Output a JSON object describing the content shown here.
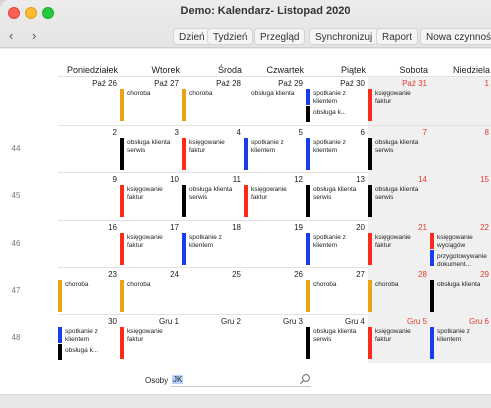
{
  "window": {
    "title": "Demo: Kalendarz- Listopad 2020"
  },
  "nav": {
    "back": "‹",
    "forward": "›"
  },
  "toolbar": [
    "Dzień",
    "Tydzień",
    "Przegląd",
    "Synchronizuj",
    "Raport",
    "Nowa czynność"
  ],
  "days": [
    "Poniedziałek",
    "Wtorek",
    "Środa",
    "Czwartek",
    "Piątek",
    "Sobota",
    "Niedziela"
  ],
  "weeks": [
    "44",
    "45",
    "46",
    "47",
    "48"
  ],
  "osoby": {
    "label": "Osoby",
    "value": "JK"
  },
  "colors": {
    "red": "#ff2a1a",
    "orange": "#e8a317",
    "black": "#000000",
    "blue": "#1a3cf0",
    "weekend": "#f0f0f0"
  },
  "grid": [
    [
      {
        "date": "Paź 26",
        "red": false,
        "events": []
      },
      {
        "date": "Paź 27",
        "red": false,
        "events": [
          {
            "color": "orange",
            "text": "choroba"
          }
        ]
      },
      {
        "date": "Paź 28",
        "red": false,
        "events": [
          {
            "color": "orange",
            "text": "choroba"
          }
        ]
      },
      {
        "date": "Paź 29",
        "red": false,
        "events": [
          {
            "color": "none",
            "text": "obsługa klienta"
          }
        ]
      },
      {
        "date": "Paź 30",
        "red": false,
        "events": [
          {
            "color": "blue",
            "text": "spotkanie z klientem"
          },
          {
            "color": "black",
            "text": "obsługa k..."
          }
        ]
      },
      {
        "date": "Paź 31",
        "red": true,
        "events": [
          {
            "color": "red",
            "text": "księgowanie faktur"
          }
        ]
      },
      {
        "date": "1",
        "red": true,
        "events": []
      }
    ],
    [
      {
        "date": "2",
        "red": false,
        "events": []
      },
      {
        "date": "3",
        "red": false,
        "events": [
          {
            "color": "black",
            "text": "obsługa klienta serwis"
          }
        ]
      },
      {
        "date": "4",
        "red": false,
        "events": [
          {
            "color": "red",
            "text": "księgowanie faktur"
          }
        ]
      },
      {
        "date": "5",
        "red": false,
        "events": [
          {
            "color": "blue",
            "text": "spotkanie z klientem"
          }
        ]
      },
      {
        "date": "6",
        "red": false,
        "events": [
          {
            "color": "blue",
            "text": "spotkanie z klientem"
          }
        ]
      },
      {
        "date": "7",
        "red": true,
        "events": [
          {
            "color": "black",
            "text": "obsługa klienta serwis"
          }
        ]
      },
      {
        "date": "8",
        "red": true,
        "events": []
      }
    ],
    [
      {
        "date": "9",
        "red": false,
        "events": []
      },
      {
        "date": "10",
        "red": false,
        "events": [
          {
            "color": "red",
            "text": "księgowanie faktur"
          }
        ]
      },
      {
        "date": "11",
        "red": false,
        "events": [
          {
            "color": "black",
            "text": "obsługa klienta serwis"
          }
        ]
      },
      {
        "date": "12",
        "red": false,
        "events": [
          {
            "color": "red",
            "text": "księgowanie faktur"
          }
        ]
      },
      {
        "date": "13",
        "red": false,
        "events": [
          {
            "color": "black",
            "text": "obsługa klienta serwis"
          }
        ]
      },
      {
        "date": "14",
        "red": true,
        "events": [
          {
            "color": "black",
            "text": "obsługa klienta serwis"
          }
        ]
      },
      {
        "date": "15",
        "red": true,
        "events": []
      }
    ],
    [
      {
        "date": "16",
        "red": false,
        "events": []
      },
      {
        "date": "17",
        "red": false,
        "events": [
          {
            "color": "red",
            "text": "księgowanie faktur"
          }
        ]
      },
      {
        "date": "18",
        "red": false,
        "events": [
          {
            "color": "blue",
            "text": "spotkanie z klientem"
          }
        ]
      },
      {
        "date": "19",
        "red": false,
        "events": []
      },
      {
        "date": "20",
        "red": false,
        "events": [
          {
            "color": "blue",
            "text": "spotkanie z klientem"
          }
        ]
      },
      {
        "date": "21",
        "red": true,
        "events": [
          {
            "color": "red",
            "text": "księgowanie faktur"
          }
        ]
      },
      {
        "date": "22",
        "red": true,
        "events": [
          {
            "color": "red",
            "text": "księgowanie wyciągów"
          },
          {
            "color": "blue",
            "text": "przygotowywanie dokument..."
          }
        ]
      }
    ],
    [
      {
        "date": "23",
        "red": false,
        "events": [
          {
            "color": "orange",
            "text": "choroba"
          }
        ]
      },
      {
        "date": "24",
        "red": false,
        "events": [
          {
            "color": "orange",
            "text": "choroba"
          }
        ]
      },
      {
        "date": "25",
        "red": false,
        "events": []
      },
      {
        "date": "26",
        "red": false,
        "events": []
      },
      {
        "date": "27",
        "red": false,
        "events": [
          {
            "color": "orange",
            "text": "choroba"
          }
        ]
      },
      {
        "date": "28",
        "red": true,
        "events": [
          {
            "color": "orange",
            "text": "choroba"
          }
        ]
      },
      {
        "date": "29",
        "red": true,
        "events": [
          {
            "color": "black",
            "text": "obsługa klienta"
          }
        ]
      }
    ],
    [
      {
        "date": "30",
        "red": false,
        "events": [
          {
            "color": "blue",
            "text": "spotkanie z klientem"
          },
          {
            "color": "black",
            "text": "obsługa k..."
          }
        ]
      },
      {
        "date": "Gru 1",
        "red": false,
        "events": [
          {
            "color": "red",
            "text": "księgowanie faktur"
          }
        ]
      },
      {
        "date": "Gru 2",
        "red": false,
        "events": []
      },
      {
        "date": "Gru 3",
        "red": false,
        "events": []
      },
      {
        "date": "Gru 4",
        "red": false,
        "events": [
          {
            "color": "black",
            "text": "obsługa klienta serwis"
          }
        ]
      },
      {
        "date": "Gru 5",
        "red": true,
        "events": [
          {
            "color": "red",
            "text": "księgowanie faktur"
          }
        ]
      },
      {
        "date": "Gru 6",
        "red": true,
        "events": [
          {
            "color": "blue",
            "text": "spotkanie z klientem"
          }
        ]
      }
    ]
  ]
}
